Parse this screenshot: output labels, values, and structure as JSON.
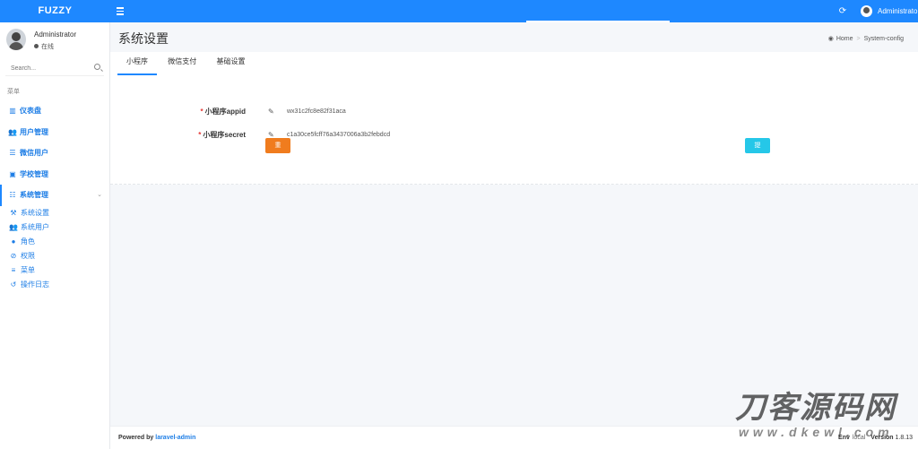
{
  "topbar": {
    "brand": "FUZZY",
    "user_name": "Administrator",
    "brand_color": "#1e88ff"
  },
  "sidebar": {
    "user": {
      "name": "Administrator",
      "status": "在线"
    },
    "search_placeholder": "Search...",
    "menu_header": "菜单",
    "items": [
      {
        "label": "仪表盘",
        "icon": "bar-chart-icon"
      },
      {
        "label": "用户管理",
        "icon": "users-icon"
      },
      {
        "label": "微信用户",
        "icon": "list-icon"
      },
      {
        "label": "学校管理",
        "icon": "school-icon"
      },
      {
        "label": "系统管理",
        "icon": "tasks-icon"
      }
    ],
    "sub_items": [
      {
        "label": "系统设置",
        "icon": "wrench-icon"
      },
      {
        "label": "系统用户",
        "icon": "users-icon"
      },
      {
        "label": "角色",
        "icon": "user-icon"
      },
      {
        "label": "权限",
        "icon": "ban-icon"
      },
      {
        "label": "菜单",
        "icon": "bars-icon"
      },
      {
        "label": "操作日志",
        "icon": "history-icon"
      }
    ]
  },
  "main": {
    "page_title": "系统设置",
    "breadcrumb": {
      "home": "Home",
      "current": "System-config"
    },
    "tabs": [
      {
        "label": "小程序",
        "active": true
      },
      {
        "label": "微信支付",
        "active": false
      },
      {
        "label": "基础设置",
        "active": false
      }
    ],
    "fields": [
      {
        "label": "小程序appid",
        "value": "wx31c2fc8e82f31aca"
      },
      {
        "label": "小程序secret",
        "value": "c1a30ce5fcff76a3437006a3b2febdcd"
      }
    ],
    "reset_label": "重置",
    "submit_label": "提交"
  },
  "footer": {
    "powered_prefix": "Powered by",
    "powered_link": "laravel-admin",
    "env_label": "Env",
    "env_value": "local",
    "version_label": "Version",
    "version_value": "1.8.13"
  },
  "watermark": {
    "title": "刀客源码网",
    "url": "www.dkewl.com"
  }
}
